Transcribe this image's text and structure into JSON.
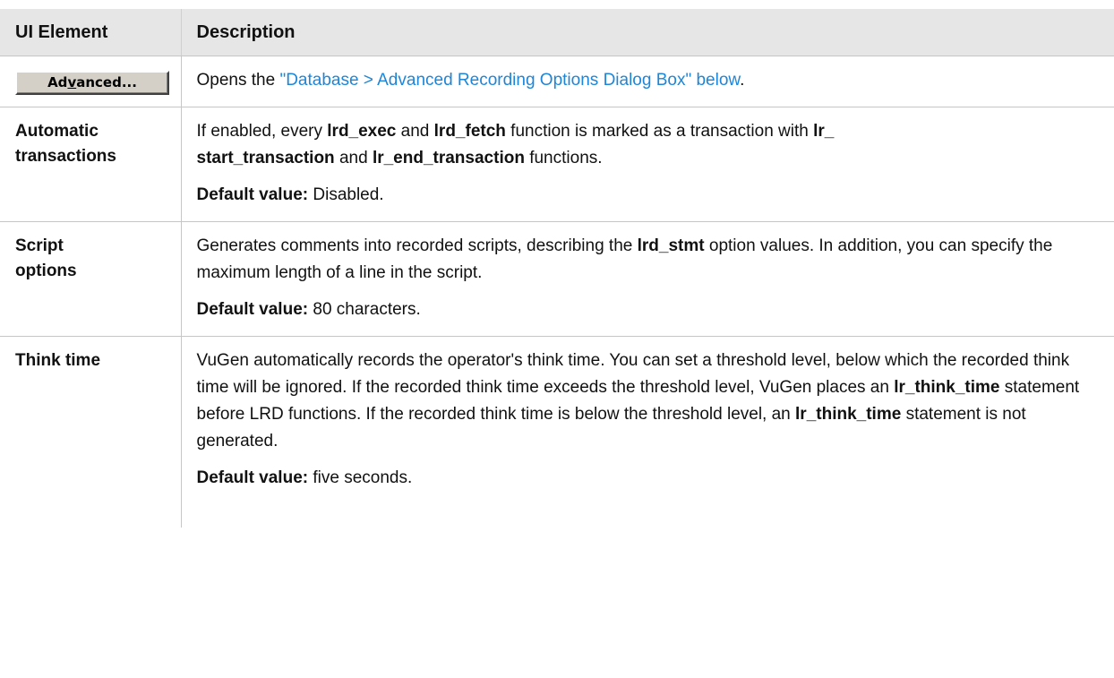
{
  "table": {
    "headers": {
      "element": "UI Element",
      "description": "Description"
    },
    "rows": {
      "advanced": {
        "button_label_pre": "Ad",
        "button_label_mnemonic": "v",
        "button_label_post": "anced...",
        "desc_pre": "Opens the ",
        "link": "\"Database > Advanced Recording Options Dialog Box\" below",
        "desc_post": "."
      },
      "auto_tx": {
        "label_line1": "Automatic",
        "label_line2": "transactions",
        "p1_a": "If enabled, every ",
        "p1_b": "lrd_exec",
        "p1_c": " and ",
        "p1_d": "lrd_fetch",
        "p1_e": " function is marked as a transaction with ",
        "p1_f": "lr_",
        "p1_g": "start_transaction",
        "p1_h": " and ",
        "p1_i": "lr_end_transaction",
        "p1_j": " functions.",
        "default_label": "Default value:",
        "default_value": " Disabled."
      },
      "script_opts": {
        "label_line1": "Script",
        "label_line2": "options",
        "p1_a": "Generates comments into recorded scripts, describing the ",
        "p1_b": "lrd_stmt",
        "p1_c": " option values. In addition, you can specify the maximum length of a line in the script.",
        "default_label": "Default value:",
        "default_value": " 80 characters."
      },
      "think_time": {
        "label": "Think time",
        "p1_a": "VuGen automatically records the operator's think time. You can set a threshold level, below which the recorded think time will be ignored. If the recorded think time exceeds the threshold level, VuGen places an ",
        "p1_b": "lr_think_time",
        "p1_c": " statement before LRD functions. If the recorded think time is below the threshold level, an ",
        "p1_d": "lr_think_time",
        "p1_e": " statement is not generated.",
        "default_label": "Default value:",
        "default_value": " five seconds."
      }
    }
  }
}
